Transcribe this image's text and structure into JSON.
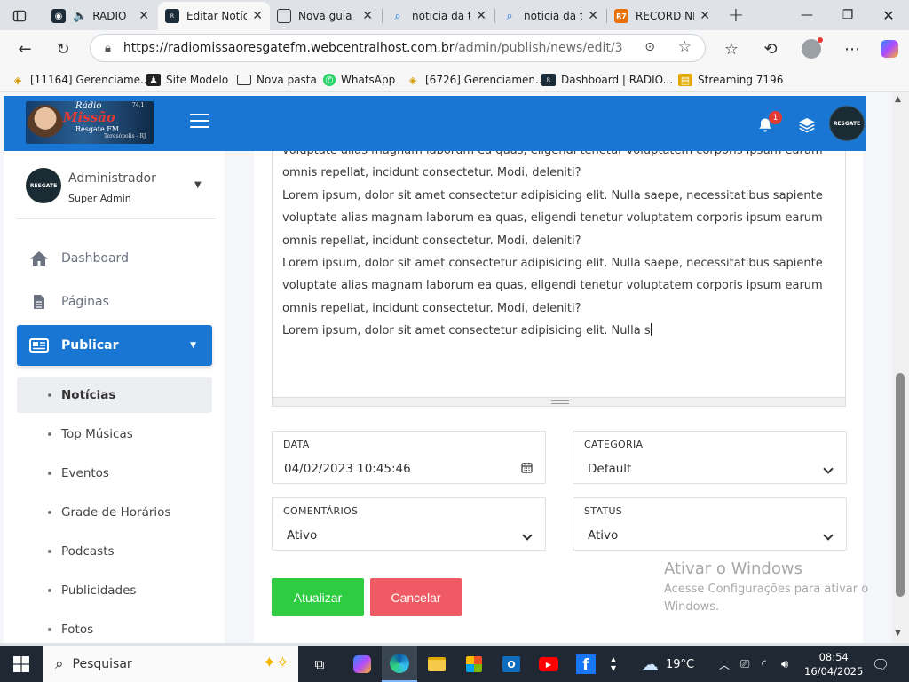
{
  "browser": {
    "tabs": [
      {
        "title": "RADIO",
        "active": false
      },
      {
        "title": "Editar Notíci",
        "active": true
      },
      {
        "title": "Nova guia",
        "active": false
      },
      {
        "title": "noticia da tv",
        "active": false
      },
      {
        "title": "noticia da tv",
        "active": false
      },
      {
        "title": "RECORD NE",
        "active": false
      }
    ],
    "url_host": "https://radiomissaoresgatefm.webcentralhost.com.br",
    "url_path": "/admin/publish/news/edit/3",
    "bookmarks": [
      "[11164] Gerenciame...",
      "Site Modelo",
      "Nova pasta",
      "WhatsApp",
      "[6726] Gerenciamen...",
      "Dashboard | RADIO...",
      "Streaming 7196"
    ]
  },
  "header": {
    "logo": {
      "line1": "Rádio",
      "line2": "Missão",
      "line3": "Resgate FM",
      "line4": "Teresópolis - RJ",
      "line5": "74,1"
    },
    "notification_count": "1",
    "avatar_text": "RESGATE"
  },
  "sidebar": {
    "user": {
      "name": "Administrador",
      "role": "Super Admin",
      "avatar_text": "RESGATE"
    },
    "nav": [
      {
        "label": "Dashboard",
        "icon": "home-icon"
      },
      {
        "label": "Páginas",
        "icon": "file-icon"
      },
      {
        "label": "Publicar",
        "icon": "newspaper-icon",
        "active": true
      }
    ],
    "subnav": [
      {
        "label": "Notícias",
        "active": true
      },
      {
        "label": "Top Músicas"
      },
      {
        "label": "Eventos"
      },
      {
        "label": "Grade de Horários"
      },
      {
        "label": "Podcasts"
      },
      {
        "label": "Publicidades"
      },
      {
        "label": "Fotos"
      }
    ]
  },
  "editor": {
    "paragraphs": [
      "voluptate alias magnam laborum ea quas, eligendi tenetur voluptatem corporis ipsum earum omnis repellat, incidunt consectetur. Modi, deleniti?",
      "Lorem ipsum, dolor sit amet consectetur adipisicing elit. Nulla saepe, necessitatibus sapiente voluptate alias magnam laborum ea quas, eligendi tenetur voluptatem corporis ipsum earum omnis repellat, incidunt consectetur. Modi, deleniti?",
      "Lorem ipsum, dolor sit amet consectetur adipisicing elit. Nulla saepe, necessitatibus sapiente voluptate alias magnam laborum ea quas, eligendi tenetur voluptatem corporis ipsum earum omnis repellat, incidunt consectetur. Modi, deleniti?",
      "Lorem ipsum, dolor sit amet consectetur adipisicing elit. Nulla s"
    ]
  },
  "form": {
    "data": {
      "label": "DATA",
      "value": "04/02/2023 10:45:46"
    },
    "categoria": {
      "label": "CATEGORIA",
      "value": "Default"
    },
    "comentarios": {
      "label": "COMENTÁRIOS",
      "value": "Ativo"
    },
    "status": {
      "label": "STATUS",
      "value": "Ativo"
    },
    "update_label": "Atualizar",
    "cancel_label": "Cancelar"
  },
  "watermark": {
    "title": "Ativar o Windows",
    "text": "Acesse Configurações para ativar o Windows."
  },
  "taskbar": {
    "search_placeholder": "Pesquisar",
    "weather": "19°C",
    "time": "08:54",
    "date": "16/04/2025"
  },
  "colors": {
    "primary": "#1976d2",
    "success": "#2ecc40",
    "danger": "#f05a64"
  }
}
